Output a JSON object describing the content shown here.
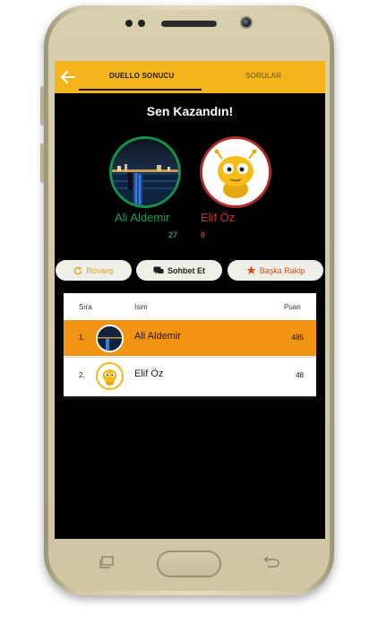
{
  "app": {
    "tabs": [
      {
        "label": "DUELLO SONUCU",
        "active": true
      },
      {
        "label": "SORULAR",
        "active": false
      }
    ],
    "back_icon": "arrow-left-icon",
    "accent_color": "#f3b51b"
  },
  "result": {
    "title": "Sen Kazandın!",
    "player1": {
      "name": "Ali Aldemir",
      "score": "27",
      "color": "#1f9b55"
    },
    "player2": {
      "name": "Elif Öz",
      "score": "0",
      "color": "#c2372f"
    }
  },
  "actions": [
    {
      "label": "Rövanş",
      "icon": "refresh-icon"
    },
    {
      "label": "Sohbet Et",
      "icon": "chat-icon"
    },
    {
      "label": "Başka Rakip",
      "icon": "star-icon"
    }
  ],
  "leaderboard": {
    "headers": {
      "rank": "Sıra",
      "name": "İsim",
      "score": "Puan"
    },
    "rows": [
      {
        "rank": "1.",
        "name": "Ali Aldemir",
        "score": "485",
        "highlight": true
      },
      {
        "rank": "2.",
        "name": "Elif Öz",
        "score": "48",
        "highlight": false
      }
    ]
  }
}
